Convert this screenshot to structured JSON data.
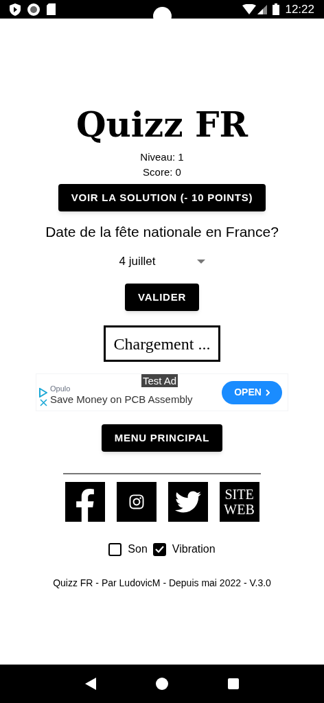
{
  "status_bar": {
    "time": "12:22"
  },
  "title": "Quizz FR",
  "level": "Niveau: 1",
  "score": "Score: 0",
  "solution_button": "VOIR LA SOLUTION (- 10 POINTS)",
  "question": "Date de la fête nationale en France?",
  "answer_dropdown": {
    "value": "4 juillet"
  },
  "validate_button": "VALIDER",
  "loading_text": "Chargement ...",
  "ad": {
    "badge": "Test Ad",
    "advertiser": "Opulo",
    "headline": "Save Money on PCB Assembly",
    "button": "OPEN"
  },
  "menu_button": "MENU PRINCIPAL",
  "social_links": [
    {
      "kind": "facebook"
    },
    {
      "kind": "instagram"
    },
    {
      "kind": "twitter"
    },
    {
      "kind": "website",
      "label": "SITE WEB"
    }
  ],
  "options": [
    {
      "label": "Son",
      "checked": false
    },
    {
      "label": "Vibration",
      "checked": true
    }
  ],
  "footer": "Quizz FR - Par LudovicM - Depuis mai 2022 - V.3.0"
}
